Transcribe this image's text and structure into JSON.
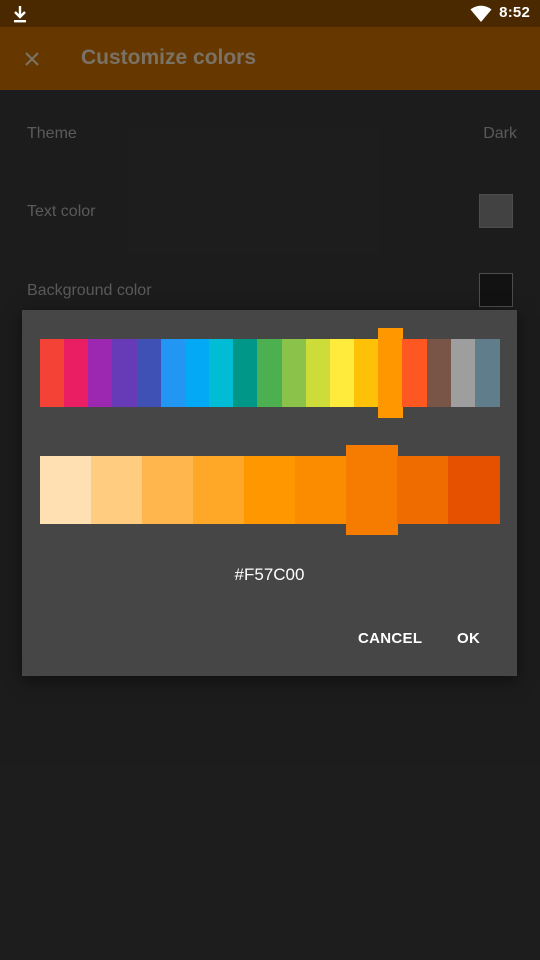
{
  "status_bar": {
    "time": "8:52",
    "icons": [
      "download-icon",
      "wifi-icon"
    ]
  },
  "toolbar": {
    "title": "Customize colors",
    "close_icon": "close-icon"
  },
  "settings": {
    "theme": {
      "label": "Theme",
      "value": "Dark"
    },
    "text_color": {
      "label": "Text color",
      "swatch_color": "#666666"
    },
    "background_color": {
      "label": "Background color",
      "swatch_color": "#1c1c1c"
    }
  },
  "dialog": {
    "palette": [
      "#F44336",
      "#E91E63",
      "#9C27B0",
      "#673AB7",
      "#3F51B5",
      "#2196F3",
      "#03A9F4",
      "#00BCD4",
      "#009688",
      "#4CAF50",
      "#8BC34A",
      "#CDDC39",
      "#FFEB3B",
      "#FFC107",
      "#FF9800",
      "#FF5722",
      "#795548",
      "#9E9E9E",
      "#607D8B"
    ],
    "palette_selected_index": 14,
    "shades": [
      "#FFE0B2",
      "#FFCC80",
      "#FFB74D",
      "#FFA726",
      "#FF9800",
      "#FB8C00",
      "#F57C00",
      "#EF6C00",
      "#E65100"
    ],
    "shades_selected_index": 6,
    "hex_value": "#F57C00",
    "cancel_label": "CANCEL",
    "ok_label": "OK"
  },
  "colors": {
    "status_bar": "#4a2800",
    "toolbar": "#663800",
    "background": "#2c2c2c",
    "dialog": "#464646"
  }
}
